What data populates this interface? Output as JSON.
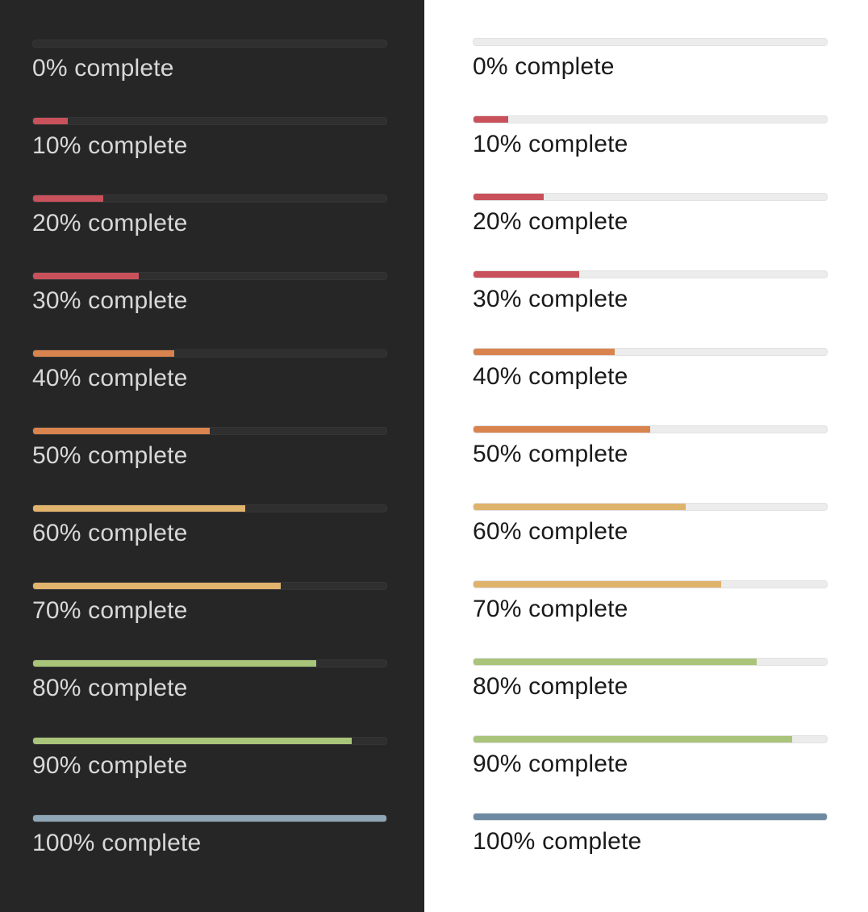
{
  "themes": [
    {
      "name": "dark",
      "bars": [
        {
          "label": "0% complete",
          "progress": 0,
          "color": "#c9515b"
        },
        {
          "label": "10% complete",
          "progress": 10,
          "color": "#c9515b"
        },
        {
          "label": "20% complete",
          "progress": 20,
          "color": "#c9515b"
        },
        {
          "label": "30% complete",
          "progress": 30,
          "color": "#c9515b"
        },
        {
          "label": "40% complete",
          "progress": 40,
          "color": "#d9844f"
        },
        {
          "label": "50% complete",
          "progress": 50,
          "color": "#d9844f"
        },
        {
          "label": "60% complete",
          "progress": 60,
          "color": "#e1b46d"
        },
        {
          "label": "70% complete",
          "progress": 70,
          "color": "#e1b46d"
        },
        {
          "label": "80% complete",
          "progress": 80,
          "color": "#a9c57a"
        },
        {
          "label": "90% complete",
          "progress": 90,
          "color": "#a9c57a"
        },
        {
          "label": "100% complete",
          "progress": 100,
          "color": "#8fa6b7"
        }
      ]
    },
    {
      "name": "light",
      "bars": [
        {
          "label": "0% complete",
          "progress": 0,
          "color": "#c9515b"
        },
        {
          "label": "10% complete",
          "progress": 10,
          "color": "#c9515b"
        },
        {
          "label": "20% complete",
          "progress": 20,
          "color": "#c9515b"
        },
        {
          "label": "30% complete",
          "progress": 30,
          "color": "#c9515b"
        },
        {
          "label": "40% complete",
          "progress": 40,
          "color": "#d9844f"
        },
        {
          "label": "50% complete",
          "progress": 50,
          "color": "#d9844f"
        },
        {
          "label": "60% complete",
          "progress": 60,
          "color": "#deb36c"
        },
        {
          "label": "70% complete",
          "progress": 70,
          "color": "#deb36c"
        },
        {
          "label": "80% complete",
          "progress": 80,
          "color": "#a9c47b"
        },
        {
          "label": "90% complete",
          "progress": 90,
          "color": "#a9c47b"
        },
        {
          "label": "100% complete",
          "progress": 100,
          "color": "#6e8aa3"
        }
      ]
    }
  ]
}
